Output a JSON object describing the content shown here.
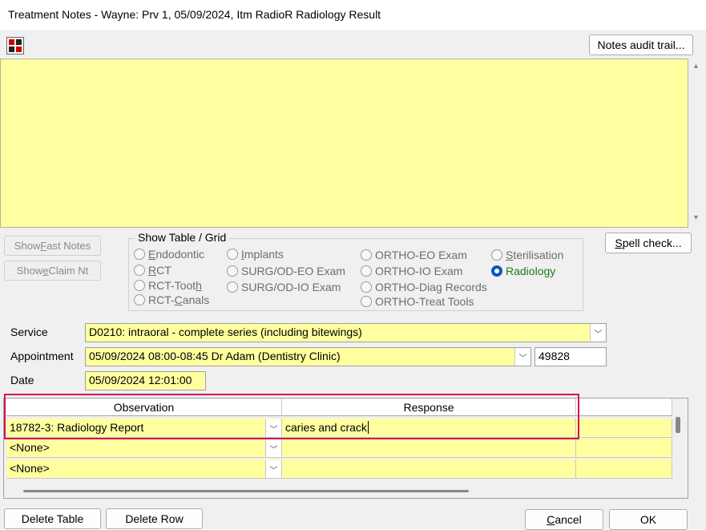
{
  "window": {
    "title": "Treatment Notes - Wayne: Prv 1, 05/09/2024, Itm RadioR Radiology Result"
  },
  "toolbar": {
    "icon": "calculator-icon",
    "audit_label": "Notes audit trail..."
  },
  "notes": {
    "value": ""
  },
  "side_buttons": {
    "fast_notes": {
      "pre": "Show ",
      "key": "F",
      "post": "ast Notes"
    },
    "eclaim": {
      "pre": "Show ",
      "key": "e",
      "post": "Claim Nt"
    }
  },
  "spell": {
    "key": "S",
    "post": "pell check..."
  },
  "show_table": {
    "legend": "Show Table / Grid",
    "radios": [
      {
        "pre": "",
        "key": "E",
        "post": "ndodontic",
        "selected": false
      },
      {
        "pre": "",
        "key": "I",
        "post": "mplants",
        "selected": false
      },
      {
        "pre": "ORTHO-EO Exam",
        "key": "",
        "post": "",
        "selected": false
      },
      {
        "pre": "",
        "key": "S",
        "post": "terilisation",
        "selected": false
      },
      {
        "pre": "",
        "key": "R",
        "post": "CT",
        "selected": false
      },
      {
        "pre": "SURG/OD-EO Exam",
        "key": "",
        "post": "",
        "selected": false
      },
      {
        "pre": "ORTHO-IO Exam",
        "key": "",
        "post": "",
        "selected": false
      },
      {
        "pre": "Radiology",
        "key": "",
        "post": "",
        "selected": true
      },
      {
        "pre": "RCT-Toot",
        "key": "h",
        "post": "",
        "selected": false
      },
      {
        "pre": "SURG/OD-IO Exam",
        "key": "",
        "post": "",
        "selected": false
      },
      {
        "pre": "ORTHO-Diag Records",
        "key": "",
        "post": "",
        "selected": false
      },
      {
        "pre": "RCT-",
        "key": "C",
        "post": "anals",
        "selected": false
      },
      {
        "pre": "ORTHO-Treat Tools",
        "key": "",
        "post": "",
        "selected": false
      }
    ]
  },
  "form": {
    "service_label": "Service",
    "service_value": "D0210: intraoral - complete series (including bitewings)",
    "appointment_label": "Appointment",
    "appointment_value": "05/09/2024 08:00-08:45 Dr Adam (Dentistry Clinic)",
    "appointment_id": "49828",
    "date_label": "Date",
    "date_value": "05/09/2024 12:01:00"
  },
  "grid": {
    "headers": [
      "Observation",
      "Response"
    ],
    "rows": [
      {
        "observation": "18782-3: Radiology Report",
        "response": "caries and crack"
      },
      {
        "observation": "<None>",
        "response": ""
      },
      {
        "observation": "<None>",
        "response": ""
      }
    ]
  },
  "footer": {
    "delete_table": "Delete Table",
    "delete_row": "Delete Row",
    "cancel": {
      "key": "C",
      "post": "ancel"
    },
    "ok": "OK"
  },
  "colors": {
    "field_bg": "#ffffa0",
    "highlight": "#d2145a",
    "radio_selected": "#0a57c2"
  }
}
